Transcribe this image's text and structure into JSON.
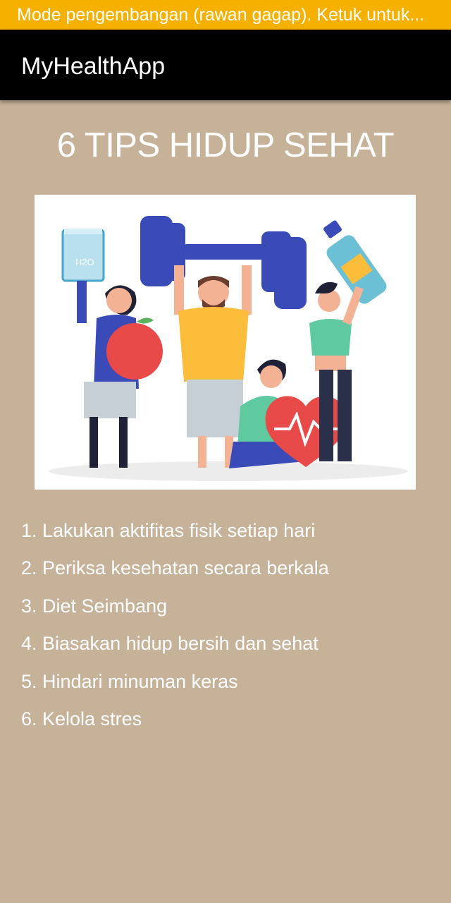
{
  "status_banner": {
    "text": "Mode pengembangan (rawan gagap). Ketuk untuk..."
  },
  "app_bar": {
    "title": "MyHealthApp"
  },
  "main": {
    "title": "6 TIPS HIDUP SEHAT",
    "illustration": {
      "water_glass_label": "H2O"
    },
    "tips": [
      "1. Lakukan aktifitas fisik setiap hari",
      "2. Periksa kesehatan secara berkala",
      "3. Diet Seimbang",
      "4. Biasakan hidup bersih dan sehat",
      "5. Hindari minuman keras",
      "6. Kelola stres"
    ]
  },
  "colors": {
    "background": "#c6b199",
    "banner": "#f5b000",
    "app_bar": "#000000",
    "text": "#ffffff"
  }
}
